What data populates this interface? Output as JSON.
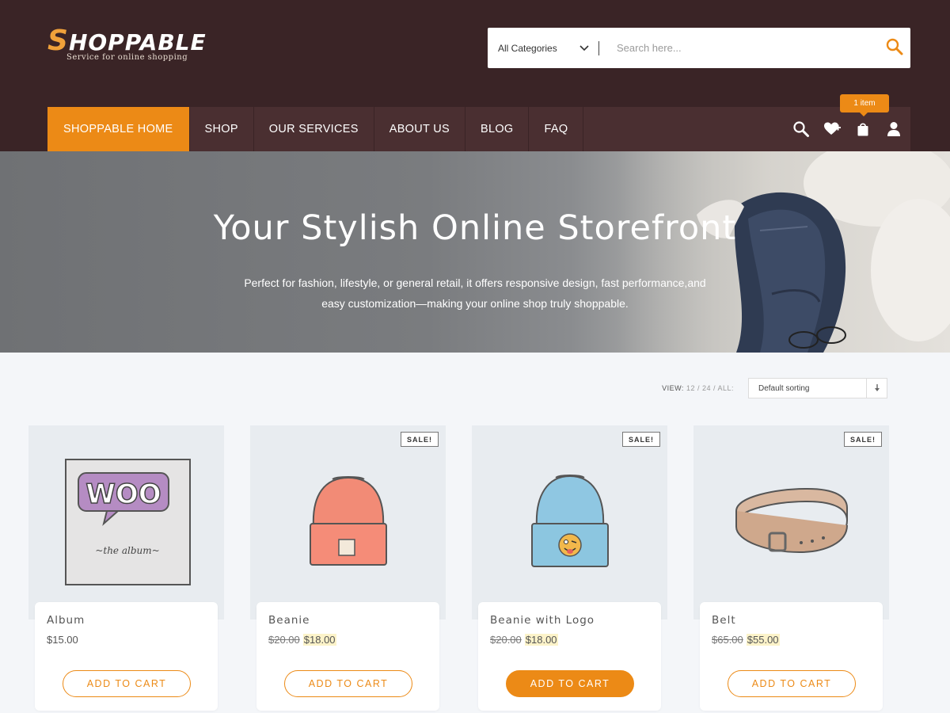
{
  "header": {
    "logo_title_first": "S",
    "logo_title_rest": "HOPPABLE",
    "logo_tagline": "Service for online shopping",
    "category_select": "All Categories",
    "search_placeholder": "Search here..."
  },
  "nav": {
    "items": [
      "SHOPPABLE HOME",
      "SHOP",
      "OUR SERVICES",
      "ABOUT US",
      "BLOG",
      "FAQ"
    ],
    "active_index": 0,
    "cart_badge": "1 item",
    "icons": [
      "search-icon",
      "wishlist-heart-icon",
      "shopping-bag-icon",
      "user-icon"
    ]
  },
  "hero": {
    "title": "Your Stylish Online Storefront",
    "subtitle_line1": "Perfect for fashion, lifestyle, or general retail, it offers responsive design, fast performance,and",
    "subtitle_line2": "easy customization—making your online shop truly shoppable."
  },
  "toolbar": {
    "view_label": "VIEW:",
    "view_options": "12 / 24 / ALL:",
    "sort_value": "Default sorting"
  },
  "products": [
    {
      "name": "Album",
      "price": "$15.00",
      "old_price": "",
      "sale": "",
      "button": "ADD TO CART",
      "image": "woo-album-image"
    },
    {
      "name": "Beanie",
      "price": "$18.00",
      "old_price": "$20.00",
      "sale": "SALE!",
      "button": "ADD TO CART",
      "image": "orange-beanie-image"
    },
    {
      "name": "Beanie with Logo",
      "price": "$18.00",
      "old_price": "$20.00",
      "sale": "SALE!",
      "button": "ADD TO CART",
      "image": "blue-beanie-logo-image"
    },
    {
      "name": "Belt",
      "price": "$55.00",
      "old_price": "$65.00",
      "sale": "SALE!",
      "button": "ADD TO CART",
      "image": "leather-belt-image"
    }
  ],
  "colors": {
    "header_bg": "#3a2426",
    "nav_bg": "#4a2f31",
    "accent": "#ec8a16",
    "logo_accent": "#f0a13a"
  }
}
